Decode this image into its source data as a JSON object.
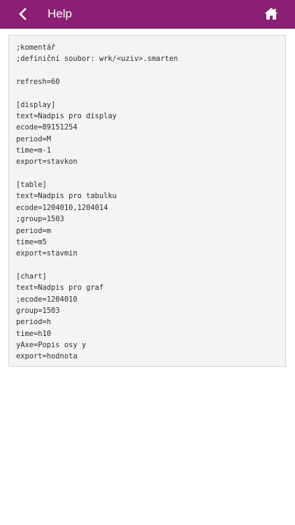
{
  "header": {
    "title": "Help",
    "back_icon": "chevron-left-icon",
    "home_icon": "home-icon",
    "background_color": "#8a1f73",
    "text_color": "#ffffff"
  },
  "help": {
    "content": ";komentář\n;definiční soubor: wrk/<uziv>.smarten\n\nrefresh=60\n\n[display]\ntext=Nadpis pro display\necode=89151254\nperiod=M\ntime=m-1\nexport=stavkon\n\n[table]\ntext=Nadpis pro tabulku\necode=1204010,1204014\n;group=1503\nperiod=m\ntime=m5\nexport=stavmin\n\n[chart]\ntext=Nadpis pro graf\n;ecode=1204010\ngroup=1503\nperiod=h\ntime=h10\nyAxe=Popis osy y\nexport=hodnota"
  }
}
